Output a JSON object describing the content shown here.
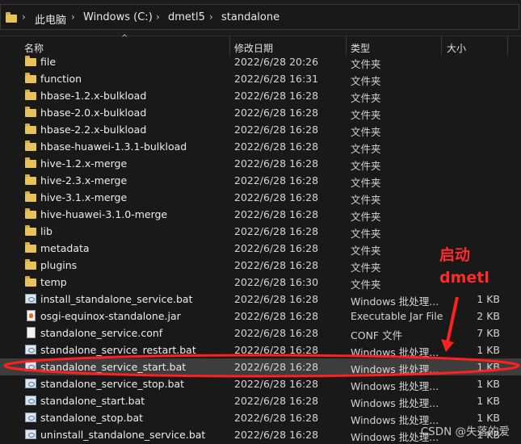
{
  "address_bar": {
    "crumbs": [
      "此电脑",
      "Windows (C:)",
      "dmetl5",
      "standalone"
    ]
  },
  "columns": {
    "name": "名称",
    "date": "修改日期",
    "type": "类型",
    "size": "大小"
  },
  "files": [
    {
      "name": "file",
      "date": "2022/6/28 20:26",
      "type": "文件夹",
      "size": "",
      "kind": "folder"
    },
    {
      "name": "function",
      "date": "2022/6/28 16:31",
      "type": "文件夹",
      "size": "",
      "kind": "folder"
    },
    {
      "name": "hbase-1.2.x-bulkload",
      "date": "2022/6/28 16:28",
      "type": "文件夹",
      "size": "",
      "kind": "folder"
    },
    {
      "name": "hbase-2.0.x-bulkload",
      "date": "2022/6/28 16:28",
      "type": "文件夹",
      "size": "",
      "kind": "folder"
    },
    {
      "name": "hbase-2.2.x-bulkload",
      "date": "2022/6/28 16:28",
      "type": "文件夹",
      "size": "",
      "kind": "folder"
    },
    {
      "name": "hbase-huawei-1.3.1-bulkload",
      "date": "2022/6/28 16:28",
      "type": "文件夹",
      "size": "",
      "kind": "folder"
    },
    {
      "name": "hive-1.2.x-merge",
      "date": "2022/6/28 16:28",
      "type": "文件夹",
      "size": "",
      "kind": "folder"
    },
    {
      "name": "hive-2.3.x-merge",
      "date": "2022/6/28 16:28",
      "type": "文件夹",
      "size": "",
      "kind": "folder"
    },
    {
      "name": "hive-3.1.x-merge",
      "date": "2022/6/28 16:28",
      "type": "文件夹",
      "size": "",
      "kind": "folder"
    },
    {
      "name": "hive-huawei-3.1.0-merge",
      "date": "2022/6/28 16:28",
      "type": "文件夹",
      "size": "",
      "kind": "folder"
    },
    {
      "name": "lib",
      "date": "2022/6/28 16:28",
      "type": "文件夹",
      "size": "",
      "kind": "folder"
    },
    {
      "name": "metadata",
      "date": "2022/6/28 16:28",
      "type": "文件夹",
      "size": "",
      "kind": "folder"
    },
    {
      "name": "plugins",
      "date": "2022/6/28 16:28",
      "type": "文件夹",
      "size": "",
      "kind": "folder"
    },
    {
      "name": "temp",
      "date": "2022/6/28 16:30",
      "type": "文件夹",
      "size": "",
      "kind": "folder"
    },
    {
      "name": "install_standalone_service.bat",
      "date": "2022/6/28 16:28",
      "type": "Windows 批处理...",
      "size": "1 KB",
      "kind": "bat"
    },
    {
      "name": "osgi-equinox-standalone.jar",
      "date": "2022/6/28 16:28",
      "type": "Executable Jar File",
      "size": "2 KB",
      "kind": "jar"
    },
    {
      "name": "standalone_service.conf",
      "date": "2022/6/28 16:28",
      "type": "CONF 文件",
      "size": "7 KB",
      "kind": "file"
    },
    {
      "name": "standalone_service_restart.bat",
      "date": "2022/6/28 16:28",
      "type": "Windows 批处理...",
      "size": "1 KB",
      "kind": "bat"
    },
    {
      "name": "standalone_service_start.bat",
      "date": "2022/6/28 16:28",
      "type": "Windows 批处理...",
      "size": "1 KB",
      "kind": "bat",
      "selected": true
    },
    {
      "name": "standalone_service_stop.bat",
      "date": "2022/6/28 16:28",
      "type": "Windows 批处理...",
      "size": "1 KB",
      "kind": "bat"
    },
    {
      "name": "standalone_start.bat",
      "date": "2022/6/28 16:28",
      "type": "Windows 批处理...",
      "size": "1 KB",
      "kind": "bat"
    },
    {
      "name": "standalone_stop.bat",
      "date": "2022/6/28 16:28",
      "type": "Windows 批处理...",
      "size": "1 KB",
      "kind": "bat"
    },
    {
      "name": "uninstall_standalone_service.bat",
      "date": "2022/6/28 16:28",
      "type": "Windows 批处理...",
      "size": "1 KB",
      "kind": "bat"
    }
  ],
  "annotation": {
    "line1": "启动",
    "line2": "dmetl",
    "color": "#ff2a2a"
  },
  "watermark": "CSDN @失落的爱"
}
